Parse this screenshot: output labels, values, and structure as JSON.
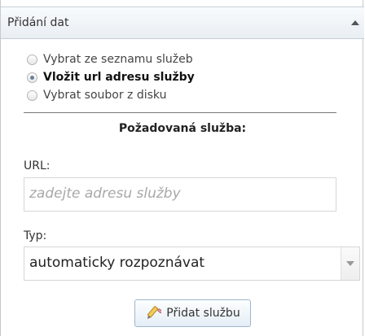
{
  "header": {
    "title": "Přidání dat",
    "icon": "collapse-up-icon"
  },
  "source_options": [
    {
      "label": "Vybrat ze seznamu služeb",
      "selected": false
    },
    {
      "label": "Vložit url adresu služby",
      "selected": true
    },
    {
      "label": "Vybrat soubor z disku",
      "selected": false
    }
  ],
  "section": {
    "title": "Požadovaná služba:"
  },
  "url_field": {
    "label": "URL:",
    "placeholder": "zadejte adresu služby",
    "value": ""
  },
  "type_field": {
    "label": "Typ:",
    "value": "automaticky rozpoznávat"
  },
  "add_button": {
    "label": "Přidat službu",
    "icon": "pencil-add-icon"
  }
}
